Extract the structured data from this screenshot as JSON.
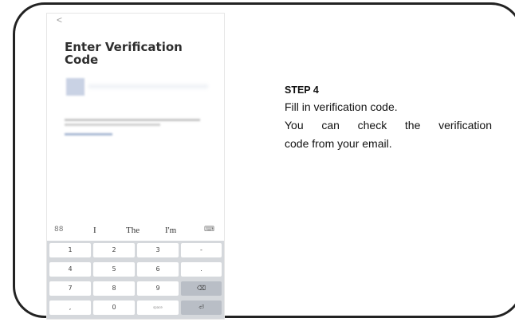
{
  "phone": {
    "back_glyph": "<",
    "title": "Enter Verification Code"
  },
  "keyboard": {
    "suggestions": [
      "88",
      "I",
      "The",
      "I'm",
      "⌨"
    ],
    "keys": [
      "1",
      "2",
      "3",
      "-",
      "4",
      "5",
      "6",
      ".",
      "7",
      "8",
      "9",
      "⌫",
      ",",
      "0",
      "space",
      "⏎"
    ]
  },
  "step": {
    "title": "STEP 4",
    "lines": [
      "Fill in verification code.",
      "You can check the verification",
      "code from your email."
    ]
  }
}
